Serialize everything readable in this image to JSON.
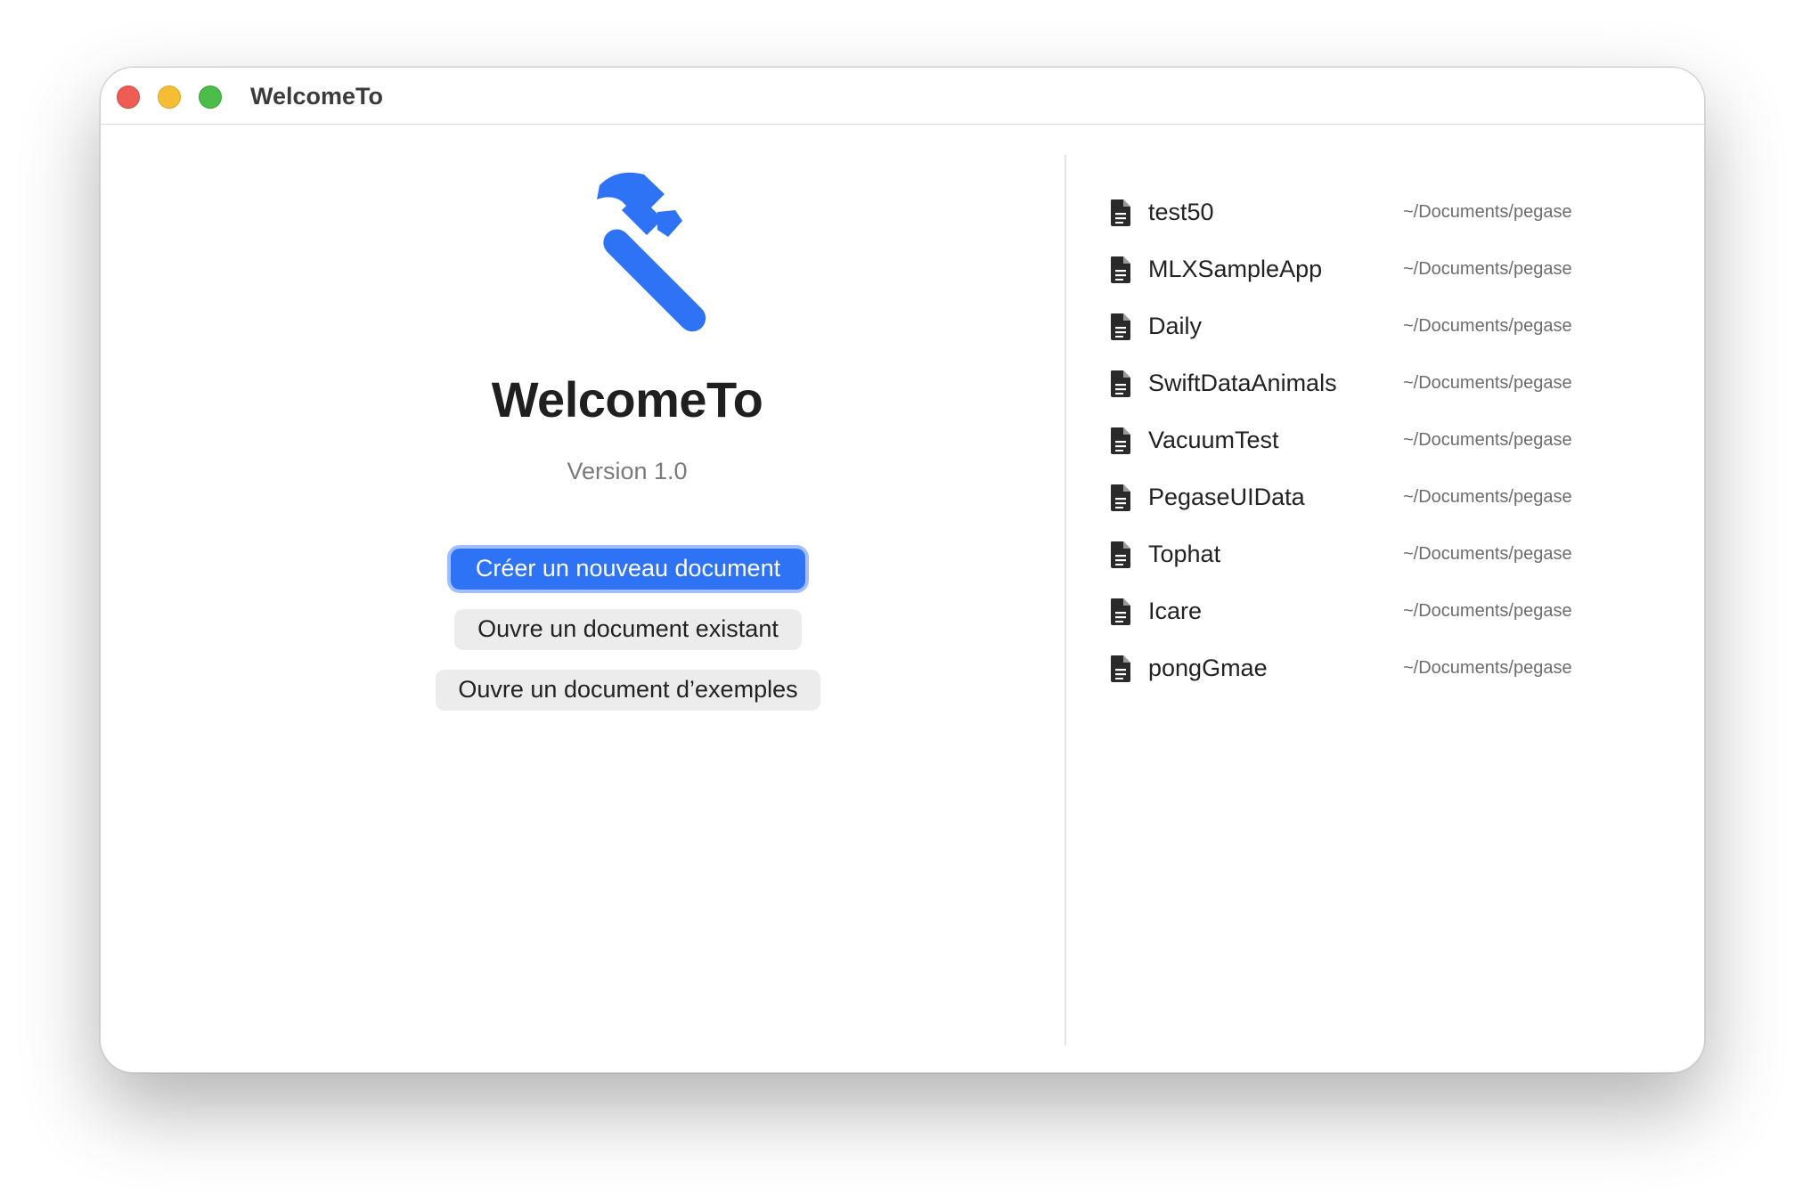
{
  "window": {
    "title": "WelcomeTo"
  },
  "welcome": {
    "icon": "hammer-icon",
    "app_name": "WelcomeTo",
    "version": "Version 1.0",
    "create_label": "Créer un nouveau document",
    "open_label": "Ouvre un document existant",
    "examples_label": "Ouvre un document d’exemples"
  },
  "recent": {
    "icon": "document-icon",
    "items": [
      {
        "name": "test50",
        "path": "~/Documents/pegase"
      },
      {
        "name": "MLXSampleApp",
        "path": "~/Documents/pegase"
      },
      {
        "name": "Daily",
        "path": "~/Documents/pegase"
      },
      {
        "name": "SwiftDataAnimals",
        "path": "~/Documents/pegase"
      },
      {
        "name": "VacuumTest",
        "path": "~/Documents/pegase"
      },
      {
        "name": "PegaseUIData",
        "path": "~/Documents/pegase"
      },
      {
        "name": "Tophat",
        "path": "~/Documents/pegase"
      },
      {
        "name": "Icare",
        "path": "~/Documents/pegase"
      },
      {
        "name": "pongGmae",
        "path": "~/Documents/pegase"
      }
    ]
  },
  "colors": {
    "accent": "#2e72f6",
    "close": "#ef5b55",
    "minimize": "#f4bd34",
    "zoom": "#4dbd4a"
  }
}
